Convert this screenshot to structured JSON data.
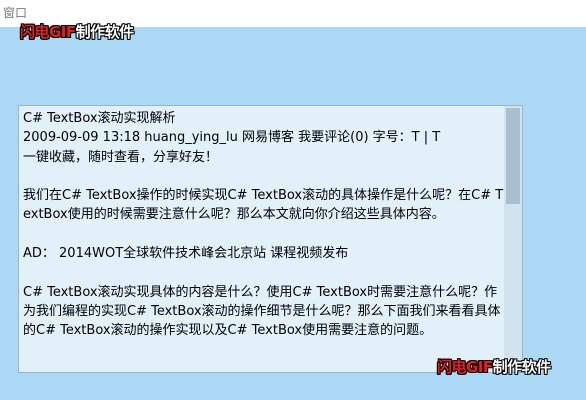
{
  "window": {
    "title": "窗口"
  },
  "watermark": {
    "brand": "闪电GIF",
    "text": "制作软件"
  },
  "textbox": {
    "lines": [
      "C# TextBox滚动实现解析",
      "2009-09-09 13:18 huang_ying_lu 网易博客 我要评论(0) 字号：T | T",
      "一键收藏，随时查看，分享好友！",
      "",
      "我们在C# TextBox操作的时候实现C# TextBox滚动的具体操作是什么呢？在C# TextBox使用的时候需要注意什么呢？那么本文就向你介绍这些具体内容。",
      "",
      "AD：  2014WOT全球软件技术峰会北京站 课程视频发布",
      "",
      "C# TextBox滚动实现具体的内容是什么？使用C# TextBox时需要注意什么呢？作为我们编程的实现C# TextBox滚动的操作细节是什么呢？那么下面我们来看看具体的C# TextBox滚动的操作实现以及C# TextBox使用需要注意的问题。"
    ]
  }
}
